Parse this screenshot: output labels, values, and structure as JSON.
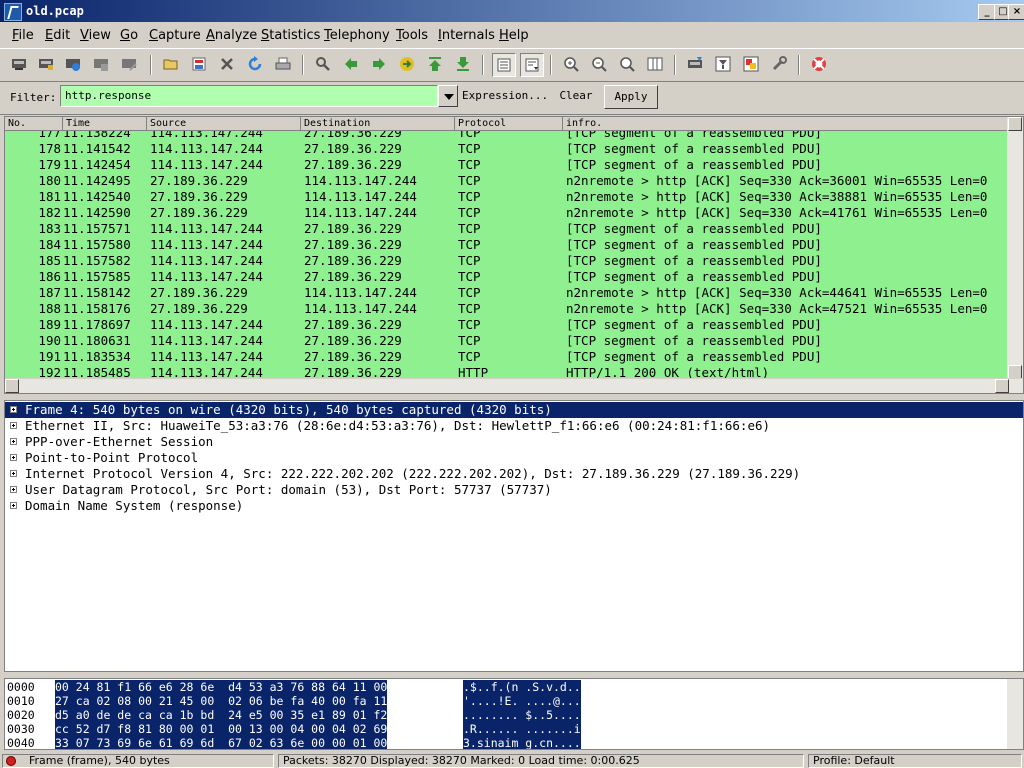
{
  "window": {
    "title": "old.pcap"
  },
  "menu": [
    "File",
    "Edit",
    "View",
    "Go",
    "Capture",
    "Analyze",
    "Statistics",
    "Telephony",
    "Tools",
    "Internals",
    "Help"
  ],
  "toolbar": {
    "icons": [
      "interface-list-icon",
      "capture-options-icon",
      "start-capture-icon",
      "stop-capture-icon",
      "restart-capture-icon",
      "open-file-icon",
      "save-file-icon",
      "close-file-icon",
      "reload-icon",
      "print-icon",
      "find-packet-icon",
      "go-back-icon",
      "go-forward-icon",
      "go-to-packet-icon",
      "go-first-icon",
      "go-last-icon",
      "colorize-icon",
      "auto-scroll-icon",
      "zoom-in-icon",
      "zoom-out-icon",
      "normal-size-icon",
      "resize-columns-icon",
      "capture-filters-icon",
      "display-filters-icon",
      "coloring-rules-icon",
      "preferences-icon",
      "help-icon"
    ]
  },
  "filter": {
    "label": "Filter:",
    "value": "http.response",
    "expression_label": "Expression...",
    "clear_label": "Clear",
    "apply_label": "Apply"
  },
  "packet_list": {
    "columns": [
      "No.",
      "Time",
      "Source",
      "Destination",
      "Protocol",
      "infro."
    ],
    "rows": [
      {
        "no": "177",
        "time": "11.138224",
        "src": "114.113.147.244",
        "dst": "27.189.36.229",
        "proto": "TCP",
        "info": "[TCP segment of a reassembled PDU]"
      },
      {
        "no": "178",
        "time": "11.141542",
        "src": "114.113.147.244",
        "dst": "27.189.36.229",
        "proto": "TCP",
        "info": "[TCP segment of a reassembled PDU]"
      },
      {
        "no": "179",
        "time": "11.142454",
        "src": "114.113.147.244",
        "dst": "27.189.36.229",
        "proto": "TCP",
        "info": "[TCP segment of a reassembled PDU]"
      },
      {
        "no": "180",
        "time": "11.142495",
        "src": "27.189.36.229",
        "dst": "114.113.147.244",
        "proto": "TCP",
        "info": "n2nremote > http [ACK] Seq=330 Ack=36001 Win=65535 Len=0"
      },
      {
        "no": "181",
        "time": "11.142540",
        "src": "27.189.36.229",
        "dst": "114.113.147.244",
        "proto": "TCP",
        "info": "n2nremote > http [ACK] Seq=330 Ack=38881 Win=65535 Len=0"
      },
      {
        "no": "182",
        "time": "11.142590",
        "src": "27.189.36.229",
        "dst": "114.113.147.244",
        "proto": "TCP",
        "info": "n2nremote > http [ACK] Seq=330 Ack=41761 Win=65535 Len=0"
      },
      {
        "no": "183",
        "time": "11.157571",
        "src": "114.113.147.244",
        "dst": "27.189.36.229",
        "proto": "TCP",
        "info": "[TCP segment of a reassembled PDU]"
      },
      {
        "no": "184",
        "time": "11.157580",
        "src": "114.113.147.244",
        "dst": "27.189.36.229",
        "proto": "TCP",
        "info": "[TCP segment of a reassembled PDU]"
      },
      {
        "no": "185",
        "time": "11.157582",
        "src": "114.113.147.244",
        "dst": "27.189.36.229",
        "proto": "TCP",
        "info": "[TCP segment of a reassembled PDU]"
      },
      {
        "no": "186",
        "time": "11.157585",
        "src": "114.113.147.244",
        "dst": "27.189.36.229",
        "proto": "TCP",
        "info": "[TCP segment of a reassembled PDU]"
      },
      {
        "no": "187",
        "time": "11.158142",
        "src": "27.189.36.229",
        "dst": "114.113.147.244",
        "proto": "TCP",
        "info": "n2nremote > http [ACK] Seq=330 Ack=44641 Win=65535 Len=0"
      },
      {
        "no": "188",
        "time": "11.158176",
        "src": "27.189.36.229",
        "dst": "114.113.147.244",
        "proto": "TCP",
        "info": "n2nremote > http [ACK] Seq=330 Ack=47521 Win=65535 Len=0"
      },
      {
        "no": "189",
        "time": "11.178697",
        "src": "114.113.147.244",
        "dst": "27.189.36.229",
        "proto": "TCP",
        "info": "[TCP segment of a reassembled PDU]"
      },
      {
        "no": "190",
        "time": "11.180631",
        "src": "114.113.147.244",
        "dst": "27.189.36.229",
        "proto": "TCP",
        "info": "[TCP segment of a reassembled PDU]"
      },
      {
        "no": "191",
        "time": "11.183534",
        "src": "114.113.147.244",
        "dst": "27.189.36.229",
        "proto": "TCP",
        "info": "[TCP segment of a reassembled PDU]"
      },
      {
        "no": "192",
        "time": "11.185485",
        "src": "114.113.147.244",
        "dst": "27.189.36.229",
        "proto": "HTTP",
        "info": "HTTP/1.1 200 OK  (text/html)"
      }
    ],
    "row_color": "#8ef08e"
  },
  "details": {
    "rows": [
      "Frame 4: 540 bytes on wire (4320 bits), 540 bytes captured (4320 bits)",
      "Ethernet II, Src: HuaweiTe_53:a3:76 (28:6e:d4:53:a3:76), Dst: HewlettP_f1:66:e6 (00:24:81:f1:66:e6)",
      "PPP-over-Ethernet Session",
      "Point-to-Point Protocol",
      "Internet Protocol Version 4, Src: 222.222.202.202 (222.222.202.202), Dst: 27.189.36.229 (27.189.36.229)",
      "User Datagram Protocol, Src Port: domain (53), Dst Port: 57737 (57737)",
      "Domain Name System (response)"
    ]
  },
  "hex": {
    "rows": [
      {
        "off": "0000",
        "hex": "00 24 81 f1 66 e6 28 6e  d4 53 a3 76 88 64 11 00",
        "ascii": ".$..f.(n .S.v.d.."
      },
      {
        "off": "0010",
        "hex": "27 ca 02 08 00 21 45 00  02 06 be fa 40 00 fa 11",
        "ascii": "'....!E. ....@..."
      },
      {
        "off": "0020",
        "hex": "d5 a0 de de ca ca 1b bd  24 e5 00 35 e1 89 01 f2",
        "ascii": "........ $..5...."
      },
      {
        "off": "0030",
        "hex": "cc 52 d7 f8 81 80 00 01  00 13 00 04 00 04 02 69",
        "ascii": ".R...... .......i"
      },
      {
        "off": "0040",
        "hex": "33 07 73 69 6e 61 69 6d  67 02 63 6e 00 00 01 00",
        "ascii": "3.sinaim g.cn...."
      },
      {
        "off": "0050",
        "hex": "01 c0 0c 00 05 00 01 00  00 08 bc 00 05 02 77 77",
        "ascii": "........ ......ww"
      }
    ]
  },
  "status": {
    "frame": "Frame (frame), 540 bytes",
    "packets": "Packets: 38270 Displayed: 38270 Marked: 0 Load time: 0:00.625",
    "profile": "Profile: Default"
  }
}
